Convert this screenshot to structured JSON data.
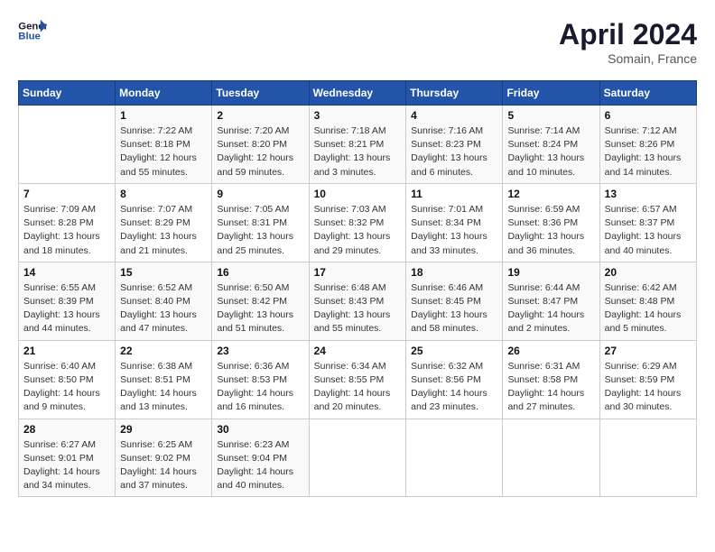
{
  "header": {
    "logo_line1": "General",
    "logo_line2": "Blue",
    "month_year": "April 2024",
    "location": "Somain, France"
  },
  "weekdays": [
    "Sunday",
    "Monday",
    "Tuesday",
    "Wednesday",
    "Thursday",
    "Friday",
    "Saturday"
  ],
  "weeks": [
    [
      {
        "day": "",
        "info": ""
      },
      {
        "day": "1",
        "info": "Sunrise: 7:22 AM\nSunset: 8:18 PM\nDaylight: 12 hours and 55 minutes."
      },
      {
        "day": "2",
        "info": "Sunrise: 7:20 AM\nSunset: 8:20 PM\nDaylight: 12 hours and 59 minutes."
      },
      {
        "day": "3",
        "info": "Sunrise: 7:18 AM\nSunset: 8:21 PM\nDaylight: 13 hours and 3 minutes."
      },
      {
        "day": "4",
        "info": "Sunrise: 7:16 AM\nSunset: 8:23 PM\nDaylight: 13 hours and 6 minutes."
      },
      {
        "day": "5",
        "info": "Sunrise: 7:14 AM\nSunset: 8:24 PM\nDaylight: 13 hours and 10 minutes."
      },
      {
        "day": "6",
        "info": "Sunrise: 7:12 AM\nSunset: 8:26 PM\nDaylight: 13 hours and 14 minutes."
      }
    ],
    [
      {
        "day": "7",
        "info": "Sunrise: 7:09 AM\nSunset: 8:28 PM\nDaylight: 13 hours and 18 minutes."
      },
      {
        "day": "8",
        "info": "Sunrise: 7:07 AM\nSunset: 8:29 PM\nDaylight: 13 hours and 21 minutes."
      },
      {
        "day": "9",
        "info": "Sunrise: 7:05 AM\nSunset: 8:31 PM\nDaylight: 13 hours and 25 minutes."
      },
      {
        "day": "10",
        "info": "Sunrise: 7:03 AM\nSunset: 8:32 PM\nDaylight: 13 hours and 29 minutes."
      },
      {
        "day": "11",
        "info": "Sunrise: 7:01 AM\nSunset: 8:34 PM\nDaylight: 13 hours and 33 minutes."
      },
      {
        "day": "12",
        "info": "Sunrise: 6:59 AM\nSunset: 8:36 PM\nDaylight: 13 hours and 36 minutes."
      },
      {
        "day": "13",
        "info": "Sunrise: 6:57 AM\nSunset: 8:37 PM\nDaylight: 13 hours and 40 minutes."
      }
    ],
    [
      {
        "day": "14",
        "info": "Sunrise: 6:55 AM\nSunset: 8:39 PM\nDaylight: 13 hours and 44 minutes."
      },
      {
        "day": "15",
        "info": "Sunrise: 6:52 AM\nSunset: 8:40 PM\nDaylight: 13 hours and 47 minutes."
      },
      {
        "day": "16",
        "info": "Sunrise: 6:50 AM\nSunset: 8:42 PM\nDaylight: 13 hours and 51 minutes."
      },
      {
        "day": "17",
        "info": "Sunrise: 6:48 AM\nSunset: 8:43 PM\nDaylight: 13 hours and 55 minutes."
      },
      {
        "day": "18",
        "info": "Sunrise: 6:46 AM\nSunset: 8:45 PM\nDaylight: 13 hours and 58 minutes."
      },
      {
        "day": "19",
        "info": "Sunrise: 6:44 AM\nSunset: 8:47 PM\nDaylight: 14 hours and 2 minutes."
      },
      {
        "day": "20",
        "info": "Sunrise: 6:42 AM\nSunset: 8:48 PM\nDaylight: 14 hours and 5 minutes."
      }
    ],
    [
      {
        "day": "21",
        "info": "Sunrise: 6:40 AM\nSunset: 8:50 PM\nDaylight: 14 hours and 9 minutes."
      },
      {
        "day": "22",
        "info": "Sunrise: 6:38 AM\nSunset: 8:51 PM\nDaylight: 14 hours and 13 minutes."
      },
      {
        "day": "23",
        "info": "Sunrise: 6:36 AM\nSunset: 8:53 PM\nDaylight: 14 hours and 16 minutes."
      },
      {
        "day": "24",
        "info": "Sunrise: 6:34 AM\nSunset: 8:55 PM\nDaylight: 14 hours and 20 minutes."
      },
      {
        "day": "25",
        "info": "Sunrise: 6:32 AM\nSunset: 8:56 PM\nDaylight: 14 hours and 23 minutes."
      },
      {
        "day": "26",
        "info": "Sunrise: 6:31 AM\nSunset: 8:58 PM\nDaylight: 14 hours and 27 minutes."
      },
      {
        "day": "27",
        "info": "Sunrise: 6:29 AM\nSunset: 8:59 PM\nDaylight: 14 hours and 30 minutes."
      }
    ],
    [
      {
        "day": "28",
        "info": "Sunrise: 6:27 AM\nSunset: 9:01 PM\nDaylight: 14 hours and 34 minutes."
      },
      {
        "day": "29",
        "info": "Sunrise: 6:25 AM\nSunset: 9:02 PM\nDaylight: 14 hours and 37 minutes."
      },
      {
        "day": "30",
        "info": "Sunrise: 6:23 AM\nSunset: 9:04 PM\nDaylight: 14 hours and 40 minutes."
      },
      {
        "day": "",
        "info": ""
      },
      {
        "day": "",
        "info": ""
      },
      {
        "day": "",
        "info": ""
      },
      {
        "day": "",
        "info": ""
      }
    ]
  ]
}
